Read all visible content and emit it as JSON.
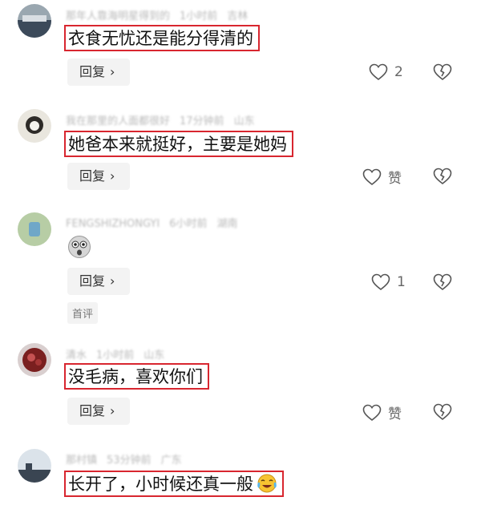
{
  "comments": [
    {
      "meta": {
        "name": "那年人靠海明星得到的",
        "time": "1小时前",
        "region": "吉林"
      },
      "text": "衣食无忧还是能分得清的",
      "reply_label": "回复",
      "like_count": "2",
      "avatar_colors": [
        "#3c4a5a",
        "#9aa7b0"
      ]
    },
    {
      "meta": {
        "name": "我在那里的人面都很好",
        "time": "17分钟前",
        "region": "山东"
      },
      "text": "她爸本来就挺好，主要是她妈",
      "reply_label": "回复",
      "like_count": "赞",
      "avatar_colors": [
        "#e9e6de",
        "#2e2b28"
      ]
    },
    {
      "meta": {
        "name": "FENGSHIZHONGYI",
        "time": "6小时前",
        "region": "湖南"
      },
      "text": "",
      "reply_label": "回复",
      "like_count": "1",
      "first_tag": "首评",
      "avatar_colors": [
        "#b7cda5",
        "#6fa7c8"
      ]
    },
    {
      "meta": {
        "name": "清水",
        "time": "1小时前",
        "region": "山东"
      },
      "text": "没毛病，喜欢你们",
      "reply_label": "回复",
      "like_count": "赞",
      "avatar_colors": [
        "#7a1f1f",
        "#c65252"
      ]
    },
    {
      "meta": {
        "name": "那村镇",
        "time": "53分钟前",
        "region": "广东"
      },
      "text": "长开了，小时候还真一般",
      "avatar_colors": [
        "#dbe3ea",
        "#3a4552"
      ]
    }
  ],
  "icons": {
    "like": "heart-icon",
    "dislike": "broken-heart-icon",
    "chevron": "chevron-right-icon"
  },
  "highlight_color": "#d8262f"
}
